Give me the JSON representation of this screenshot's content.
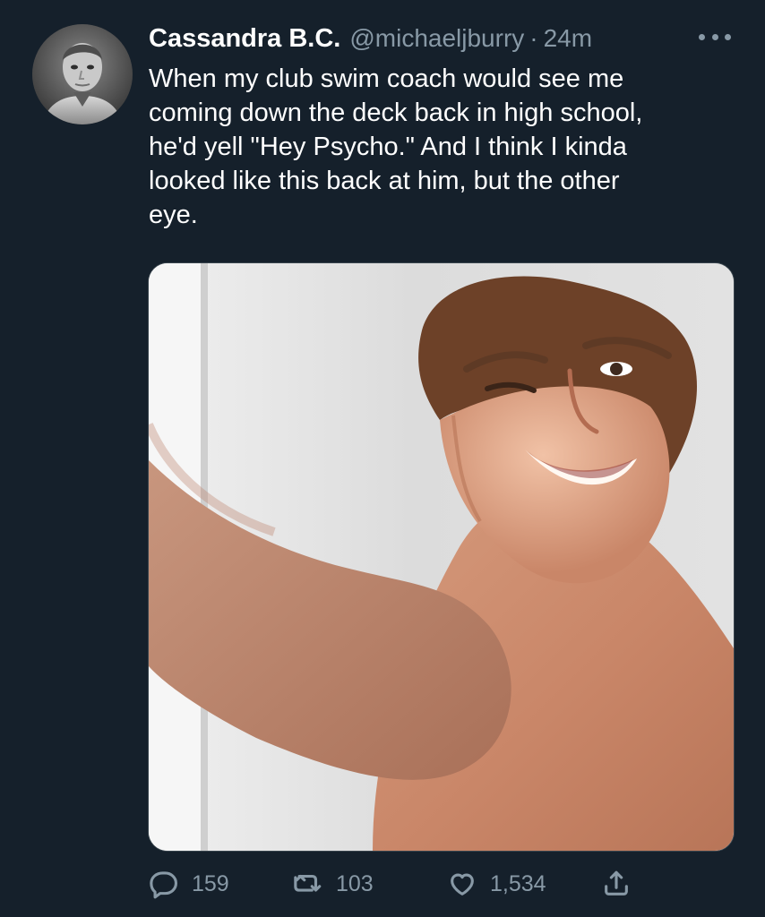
{
  "tweet": {
    "display_name": "Cassandra B.C.",
    "handle": "@michaeljburry",
    "separator": "·",
    "time": "24m",
    "text": "When my club swim coach would see me\ncoming down the deck back in high school,\nhe'd yell \"Hey Psycho.\" And I think I kinda\nlooked like this back at him, but the other\neye.",
    "avatar": {
      "style": "grayscale portrait"
    },
    "media": {
      "type": "photo"
    },
    "actions": {
      "reply": {
        "icon": "reply-icon",
        "count": "159"
      },
      "retweet": {
        "icon": "retweet-icon",
        "count": "103"
      },
      "like": {
        "icon": "heart-icon",
        "count": "1,534"
      },
      "share": {
        "icon": "share-icon"
      }
    },
    "more_icon": "more-icon"
  },
  "colors": {
    "background": "#15202b",
    "text_primary": "#ffffff",
    "text_secondary": "#8899a6",
    "border": "#38444d"
  }
}
